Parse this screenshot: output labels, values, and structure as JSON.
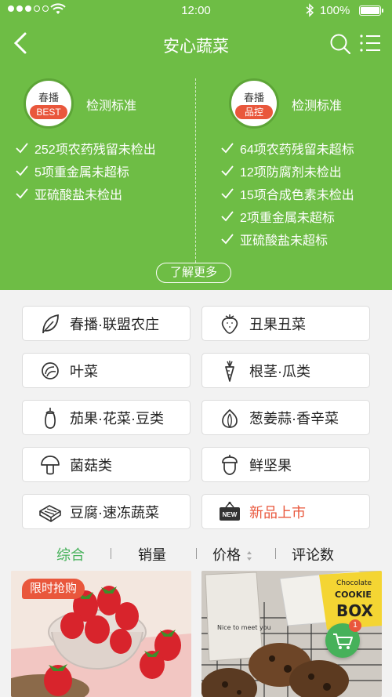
{
  "status_bar": {
    "time": "12:00",
    "battery": "100%"
  },
  "header": {
    "title": "安心蔬菜"
  },
  "standards": [
    {
      "badge_top": "春播",
      "badge_tag": "BEST",
      "label": "检测标准",
      "items": [
        "252项农药残留未检出",
        "5项重金属未超标",
        "亚硫酸盐未检出"
      ]
    },
    {
      "badge_top": "春播",
      "badge_tag": "品控",
      "label": "检测标准",
      "items": [
        "64项农药残留未超标",
        "12项防腐剂未检出",
        "15项合成色素未检出",
        "2项重金属未超标",
        "亚硫酸盐未超标"
      ]
    }
  ],
  "more_button": "了解更多",
  "categories": [
    {
      "label": "春播·联盟农庄",
      "icon": "leaf-icon"
    },
    {
      "label": "丑果丑菜",
      "icon": "strawberry-icon"
    },
    {
      "label": "叶菜",
      "icon": "cabbage-icon"
    },
    {
      "label": "根茎·瓜类",
      "icon": "carrot-icon"
    },
    {
      "label": "茄果·花菜·豆类",
      "icon": "eggplant-icon"
    },
    {
      "label": "葱姜蒜·香辛菜",
      "icon": "garlic-icon"
    },
    {
      "label": "菌菇类",
      "icon": "mushroom-icon"
    },
    {
      "label": "鲜坚果",
      "icon": "nut-icon"
    },
    {
      "label": "豆腐·速冻蔬菜",
      "icon": "tofu-icon"
    },
    {
      "label": "新品上市",
      "icon": "new-tag-icon",
      "badge_text": "NEW",
      "accent": "#e9573c"
    }
  ],
  "sort_tabs": [
    "综合",
    "销量",
    "价格",
    "评论数"
  ],
  "products": {
    "left_tag": "限时抢购",
    "right_texts": [
      "Chocolate",
      "COOKIE",
      "BOX",
      "Nice to meet you"
    ]
  },
  "cart": {
    "count": "1"
  },
  "colors": {
    "primary_green": "#6ebd45",
    "accent_red": "#e9573c",
    "tab_active": "#46b15a"
  }
}
